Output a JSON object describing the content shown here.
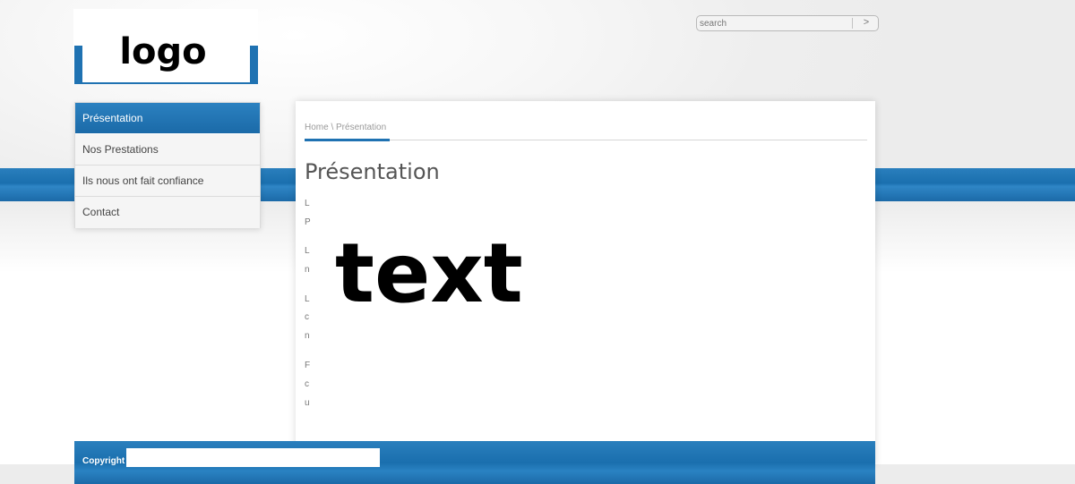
{
  "logo": {
    "text": "logo"
  },
  "search": {
    "placeholder": "search",
    "button_glyph": ">"
  },
  "nav": {
    "items": [
      {
        "label": "Présentation",
        "active": true
      },
      {
        "label": "Nos Prestations"
      },
      {
        "label": "Ils nous ont fait confiance"
      },
      {
        "label": "Contact"
      }
    ]
  },
  "content": {
    "breadcrumb": "Home \\ Présentation",
    "title": "Présentation",
    "overlay_text": "text",
    "paragraph_fragments": [
      "L",
      "P",
      "L",
      "n",
      "L",
      "c",
      "n",
      "F",
      "c",
      "u"
    ]
  },
  "footer": {
    "copyright": "Copyright"
  },
  "colors": {
    "brand_blue": "#1f72b2",
    "background": "#ececec"
  }
}
